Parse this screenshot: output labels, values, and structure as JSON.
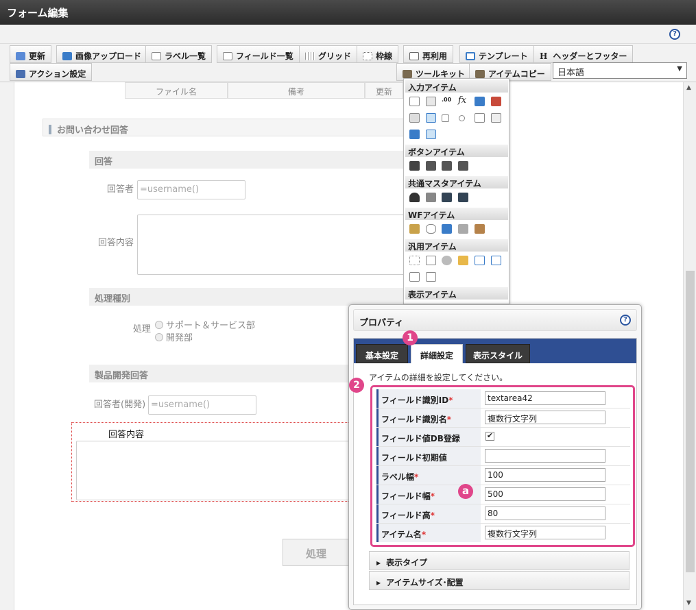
{
  "window": {
    "title": "フォーム編集"
  },
  "toolbar": {
    "row1": [
      "更新",
      "画像アップロード",
      "ラベル一覧",
      "フィールド一覧",
      "グリッド",
      "枠線",
      "再利用",
      "テンプレート",
      "ヘッダーとフッター"
    ],
    "row2_left": "アクション設定",
    "toolkit": "ツールキット",
    "item_copy": "アイテムコピー",
    "language": "日本語",
    "header_icon_letter": "H"
  },
  "table_header": {
    "filename": "ファイル名",
    "note": "備考",
    "updated": "更新"
  },
  "form": {
    "section_inquiry": "お問い合わせ回答",
    "section_answer": "回答",
    "respondent_label": "回答者",
    "respondent_value": "=username()",
    "answer_content_label": "回答内容",
    "section_processing": "処理種別",
    "processing_label": "処理",
    "radio1": "サポート＆サービス部",
    "radio2": "開発部",
    "section_dev": "製品開発回答",
    "dev_respondent_label": "回答者(開発)",
    "dev_respondent_value": "=username()",
    "dev_answer_label": "回答内容",
    "process_button": "処理"
  },
  "palette": {
    "input_items": "入力アイテム",
    "button_items": "ボタンアイテム",
    "master_items": "共通マスタアイテム",
    "wf_items": "WFアイテム",
    "general_items": "汎用アイテム",
    "display_items": "表示アイテム",
    "icon_text": [
      ".00",
      "fx"
    ]
  },
  "dialog": {
    "title": "プロパティ",
    "tabs": [
      "基本設定",
      "詳細設定",
      "表示スタイル"
    ],
    "active_tab": 1,
    "description": "アイテムの詳細を設定してください。",
    "properties": [
      {
        "label": "フィールド識別ID",
        "required": "*",
        "value": "textarea42"
      },
      {
        "label": "フィールド識別名",
        "required": "*",
        "value": "複数行文字列"
      },
      {
        "label": "フィールド値DB登録",
        "required": "",
        "checked": "✔"
      },
      {
        "label": "フィールド初期値",
        "required": "",
        "value": ""
      },
      {
        "label": "ラベル幅",
        "required": "*",
        "value": "100"
      },
      {
        "label": "フィールド幅",
        "required": "*",
        "value": "500"
      },
      {
        "label": "フィールド高",
        "required": "*",
        "value": "80"
      },
      {
        "label": "アイテム名",
        "required": "*",
        "value": "複数行文字列"
      }
    ],
    "accordion1": "表示タイプ",
    "accordion2": "アイテムサイズ･配置"
  },
  "annotations": {
    "badge1": "1",
    "badge2": "2",
    "badgeA": "a"
  },
  "colors": {
    "highlight": "#e0468a",
    "tabbar": "#2f4f93"
  }
}
